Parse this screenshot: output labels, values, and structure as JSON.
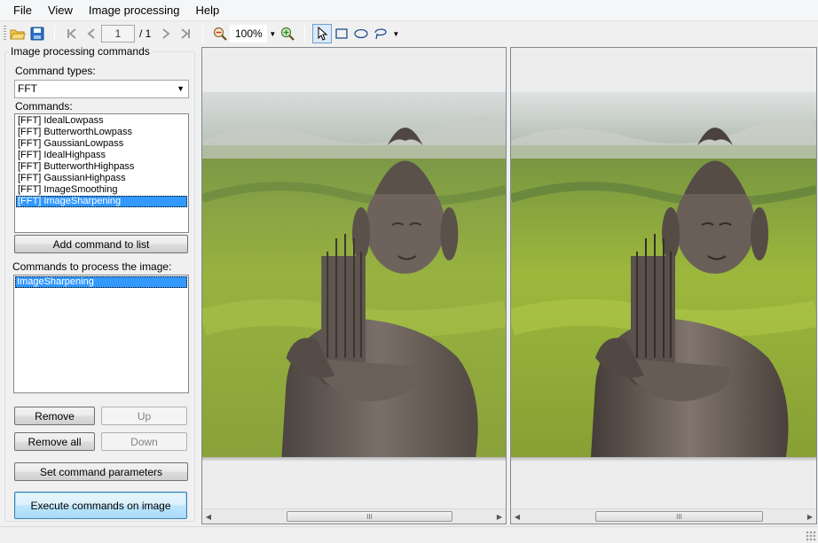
{
  "menu": [
    "File",
    "View",
    "Image processing",
    "Help"
  ],
  "toolbar": {
    "page_current": "1",
    "page_total": "/ 1",
    "zoom": "100%",
    "icons": [
      "open-folder-icon",
      "save-icon",
      "first-page-icon",
      "prev-page-icon",
      "next-page-icon",
      "last-page-icon",
      "zoom-out-icon",
      "zoom-in-icon",
      "pointer-icon",
      "rectangle-icon",
      "ellipse-icon",
      "lasso-icon"
    ]
  },
  "panel": {
    "title": "Image processing commands",
    "command_types_label": "Command types:",
    "command_type_value": "FFT",
    "commands_label": "Commands:",
    "commands": [
      "[FFT] IdealLowpass",
      "[FFT] ButterworthLowpass",
      "[FFT] GaussianLowpass",
      "[FFT] IdealHighpass",
      "[FFT] ButterworthHighpass",
      "[FFT] GaussianHighpass",
      "[FFT] ImageSmoothing",
      "[FFT] ImageSharpening"
    ],
    "selected_command_index": 7,
    "add_command_label": "Add command to list",
    "process_label": "Commands to process the image:",
    "process_list": [
      "ImageSharpening"
    ],
    "remove_label": "Remove",
    "up_label": "Up",
    "remove_all_label": "Remove all",
    "down_label": "Down",
    "set_params_label": "Set command parameters",
    "execute_label": "Execute commands on image"
  },
  "scrollbar_grip": "III"
}
